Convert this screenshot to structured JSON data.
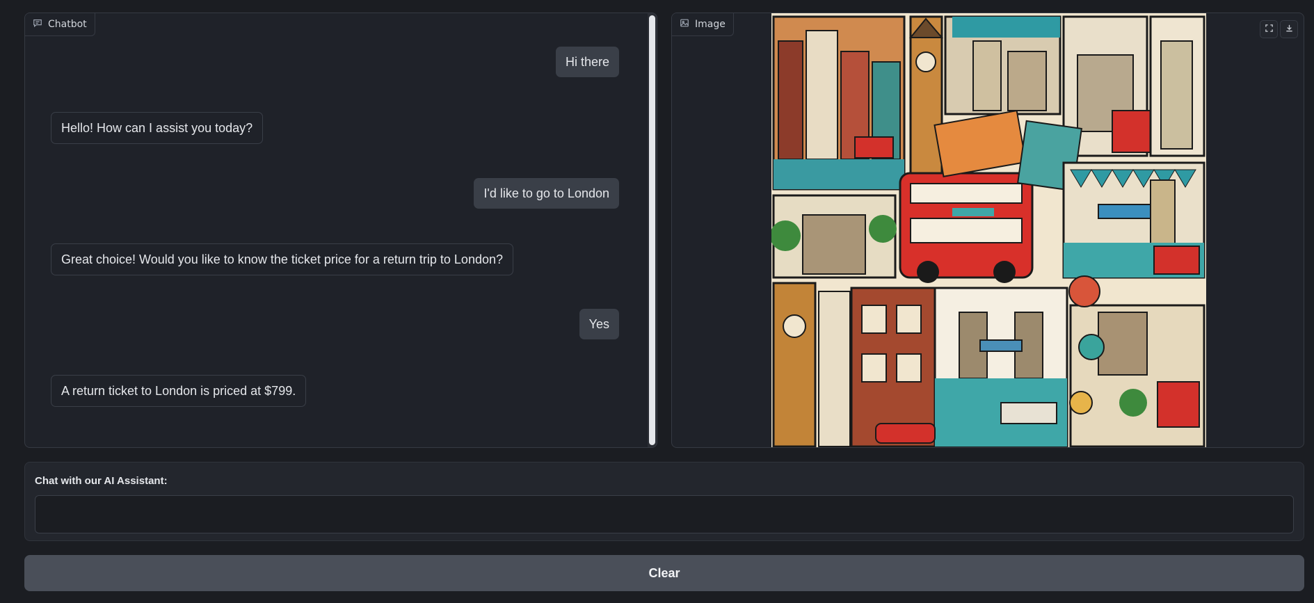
{
  "chatbot": {
    "label": "Chatbot",
    "messages": [
      {
        "role": "user",
        "text": "Hi there"
      },
      {
        "role": "bot",
        "text": "Hello! How can I assist you today?"
      },
      {
        "role": "user",
        "text": "I'd like to go to London"
      },
      {
        "role": "bot",
        "text": "Great choice! Would you like to know the ticket price for a return trip to London?"
      },
      {
        "role": "user",
        "text": "Yes"
      },
      {
        "role": "bot",
        "text": "A return ticket to London is priced at $799."
      }
    ]
  },
  "image_panel": {
    "label": "Image",
    "buttons": [
      {
        "icon": "fullscreen-icon"
      },
      {
        "icon": "download-icon"
      }
    ],
    "image_alt": "Illustrated collage of London landmarks"
  },
  "input": {
    "label": "Chat with our AI Assistant:",
    "value": "",
    "placeholder": ""
  },
  "actions": {
    "clear_label": "Clear"
  },
  "colors": {
    "background": "#1b1d22",
    "panel": "#1f2229",
    "user_bubble": "#3a3f48",
    "button": "#4a4f59"
  }
}
